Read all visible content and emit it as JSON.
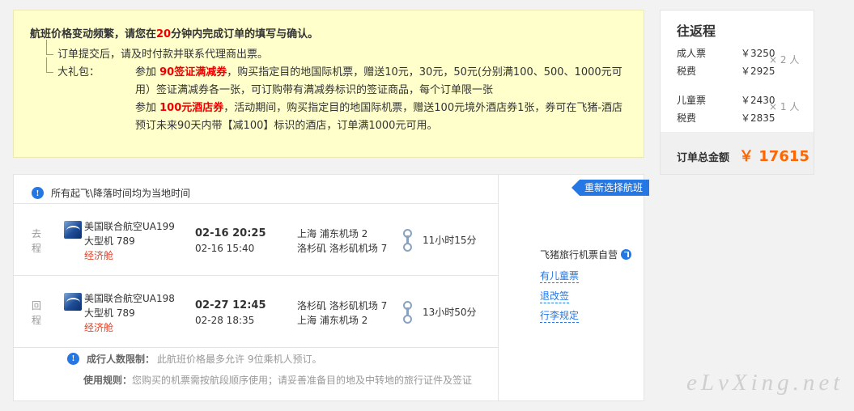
{
  "notice": {
    "headline_pre": "航班价格变动频繁，请您在",
    "headline_num": "20",
    "headline_post": "分钟内完成订单的填写与确认。",
    "ticketing": "订单提交后，请及时付款并联系代理商出票。",
    "gift_label": "大礼包：",
    "gift1_pre": "参加 ",
    "gift1_hl": "90签证满减券",
    "gift1_post": "，购买指定目的地国际机票，赠送10元，30元，50元(分别满100、500、1000元可用）签证满减券各一张，可订购带有满减券标识的签证商品，每个订单限一张",
    "gift2_pre": "参加 ",
    "gift2_hl": "100元酒店券",
    "gift2_post": "，活动期间，购买指定目的地国际机票，赠送100元境外酒店券1张，券可在飞猪-酒店预订未来90天内带【减100】标识的酒店，订单满1000元可用。"
  },
  "price": {
    "title": "往返程",
    "adult_label": "成人票",
    "adult_price": "￥3250",
    "adult_tax_label": "税费",
    "adult_tax": "￥2925",
    "adult_mult": "× 2 人",
    "child_label": "儿童票",
    "child_price": "￥2430",
    "child_tax_label": "税费",
    "child_tax": "￥2835",
    "child_mult": "× 1 人",
    "total_label": "订单总金额",
    "total_value": "￥ 17615"
  },
  "flight": {
    "tip": "所有起飞\\降落时间均为当地时间",
    "rebook": "重新选择航班",
    "segments": [
      {
        "dir": "去程",
        "airline": "美国联合航空UA199",
        "aircraft": "大型机 789",
        "cabin": "经济舱",
        "dep_time": "02-16 20:25",
        "arr_time": "02-16 15:40",
        "dep_port": "上海 浦东机场 2",
        "arr_port": "洛杉矶 洛杉矶机场 7",
        "duration": "11小时15分"
      },
      {
        "dir": "回程",
        "airline": "美国联合航空UA198",
        "aircraft": "大型机 789",
        "cabin": "经济舱",
        "dep_time": "02-27 12:45",
        "arr_time": "02-28 18:35",
        "dep_port": "洛杉矶 洛杉矶机场 7",
        "arr_port": "上海 浦东机场 2",
        "duration": "13小时50分"
      }
    ],
    "limit_label": "成行人数限制：",
    "limit_text": "此航班价格最多允许 9位乘机人预订。",
    "rule_label": "使用规则：",
    "rule_text": "您购买的机票需按航段顺序使用；请妥善准备目的地及中转地的旅行证件及签证",
    "vendor": "飞猪旅行机票自营",
    "links": [
      "有儿童票",
      "退改签",
      "行李规定"
    ]
  },
  "watermark": "eLvXing.net",
  "colors": {
    "accent_blue": "#2577e3",
    "highlight_red": "#e00000",
    "total_orange": "#ff6600",
    "notice_bg": "#ffffcc"
  }
}
